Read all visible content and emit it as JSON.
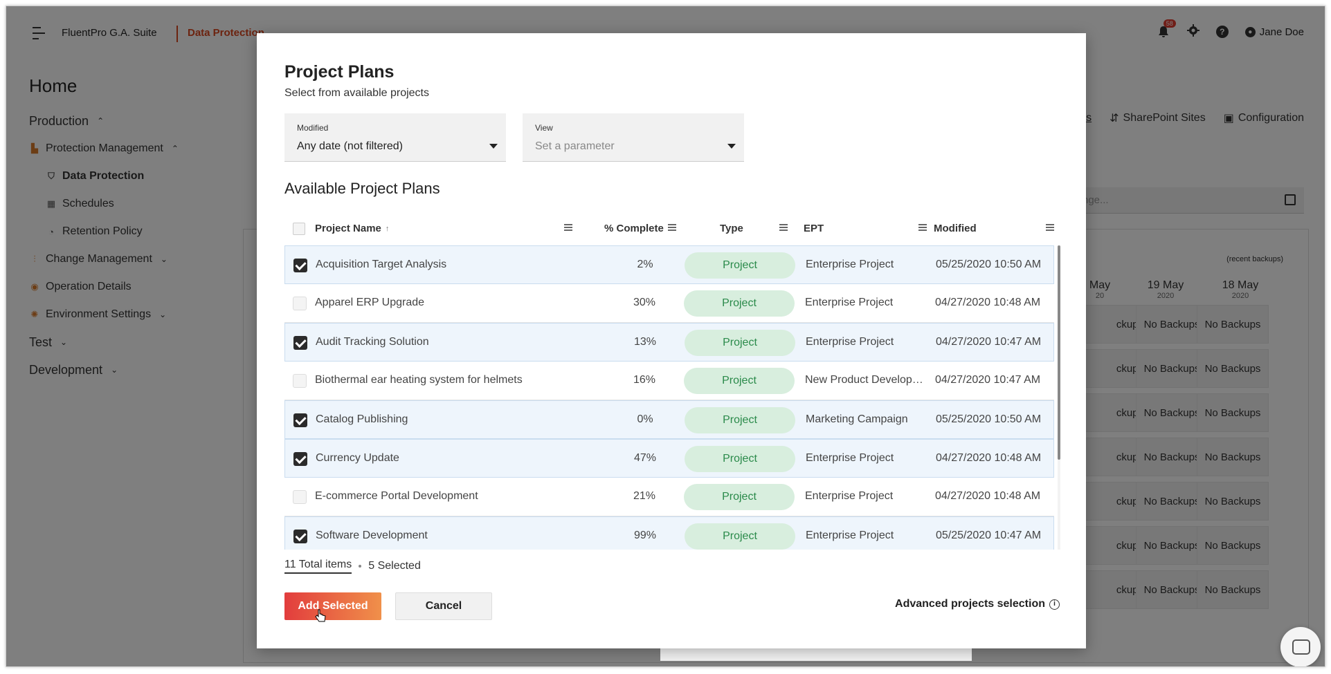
{
  "app": {
    "name": "FluentPro G.A. Suite",
    "section": "Data Protection",
    "notifications_count": "58",
    "user_name": "Jane Doe"
  },
  "sidebar": {
    "home": "Home",
    "items": [
      {
        "label": "Production",
        "level": 0
      },
      {
        "label": "Protection Management",
        "level": 1
      },
      {
        "label": "Data Protection",
        "level": 2
      },
      {
        "label": "Schedules",
        "level": 2
      },
      {
        "label": "Retention Policy",
        "level": 2
      },
      {
        "label": "Change Management",
        "level": 1
      },
      {
        "label": "Operation Details",
        "level": 1
      },
      {
        "label": "Environment Settings",
        "level": 1
      },
      {
        "label": "Test",
        "level": 0
      },
      {
        "label": "Development",
        "level": 0
      }
    ]
  },
  "background": {
    "tabs": [
      "s",
      "SharePoint Sites",
      "Configuration"
    ],
    "date_placeholder": "nge...",
    "recent_backups": "(recent backups)",
    "dates": [
      {
        "day": "Мay",
        "year": "20"
      },
      {
        "day": "19 May",
        "year": "2020"
      },
      {
        "day": "18 May",
        "year": "2020"
      }
    ],
    "no_backups": "No Backups",
    "no_backups_partial": "ckups"
  },
  "modal": {
    "title": "Project Plans",
    "subtitle": "Select from available projects",
    "filters": {
      "modified_label": "Modified",
      "modified_value": "Any date (not filtered)",
      "view_label": "View",
      "view_placeholder": "Set a parameter"
    },
    "section_title": "Available Project Plans",
    "columns": {
      "name": "Project Name",
      "sort_indicator": "↑",
      "complete": "% Complete",
      "type": "Type",
      "ept": "EPT",
      "modified": "Modified"
    },
    "rows": [
      {
        "selected": true,
        "name": "Acquisition Target Analysis",
        "complete": "2%",
        "type": "Project",
        "ept": "Enterprise Project",
        "modified": "05/25/2020 10:50 AM"
      },
      {
        "selected": false,
        "name": "Apparel ERP Upgrade",
        "complete": "30%",
        "type": "Project",
        "ept": "Enterprise Project",
        "modified": "04/27/2020 10:48 AM"
      },
      {
        "selected": true,
        "name": "Audit Tracking Solution",
        "complete": "13%",
        "type": "Project",
        "ept": "Enterprise Project",
        "modified": "04/27/2020 10:47 AM"
      },
      {
        "selected": false,
        "name": "Biothermal ear heating system for helmets",
        "complete": "16%",
        "type": "Project",
        "ept": "New Product Development",
        "modified": "04/27/2020 10:47 AM"
      },
      {
        "selected": true,
        "name": "Catalog Publishing",
        "complete": "0%",
        "type": "Project",
        "ept": "Marketing Campaign",
        "modified": "05/25/2020 10:50 AM"
      },
      {
        "selected": true,
        "name": "Currency Update",
        "complete": "47%",
        "type": "Project",
        "ept": "Enterprise Project",
        "modified": "04/27/2020 10:48 AM"
      },
      {
        "selected": false,
        "name": "E-commerce Portal Development",
        "complete": "21%",
        "type": "Project",
        "ept": "Enterprise Project",
        "modified": "04/27/2020 10:48 AM"
      },
      {
        "selected": true,
        "name": "Software Development",
        "complete": "99%",
        "type": "Project",
        "ept": "Enterprise Project",
        "modified": "05/25/2020 10:47 AM"
      }
    ],
    "footer": {
      "total": "11 Total items",
      "selected": "5 Selected"
    },
    "buttons": {
      "add": "Add Selected",
      "cancel": "Cancel",
      "advanced": "Advanced projects selection"
    }
  }
}
